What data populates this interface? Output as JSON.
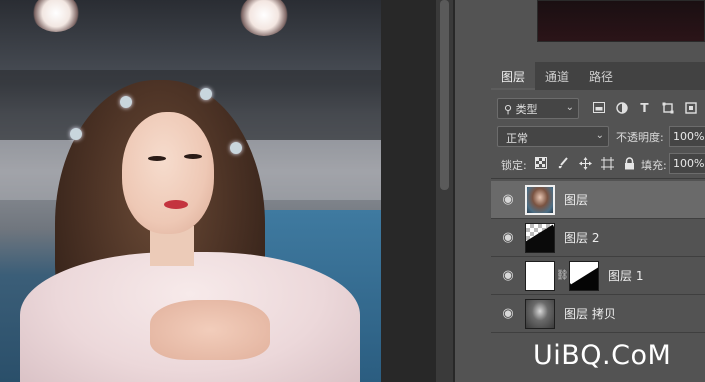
{
  "layers_panel": {
    "tabs": [
      {
        "label": "图层",
        "active": true
      },
      {
        "label": "通道",
        "active": false
      },
      {
        "label": "路径",
        "active": false
      }
    ],
    "filter": {
      "value": "类型",
      "icon": "search-icon"
    },
    "filter_icons": [
      "image-filter-icon",
      "adjustment-filter-icon",
      "type-filter-icon",
      "shape-filter-icon",
      "smart-object-filter-icon"
    ],
    "blend_mode": "正常",
    "opacity_label": "不透明度:",
    "opacity_value": "100%",
    "lock_label": "锁定:",
    "lock_icons": [
      "lock-transparent-icon",
      "lock-paint-icon",
      "lock-position-icon",
      "lock-artboard-icon",
      "lock-all-icon"
    ],
    "fill_label": "填充:",
    "fill_value": "100%",
    "layers": [
      {
        "name": "图层",
        "visible": true,
        "selected": true,
        "thumbnail": "photo"
      },
      {
        "name": "图层 2",
        "visible": true,
        "selected": false,
        "thumbnail": "transparent-mask"
      },
      {
        "name": "图层 1",
        "visible": true,
        "selected": false,
        "thumbnail": "white-with-mask"
      },
      {
        "name": "图层  拷贝",
        "visible": true,
        "selected": false,
        "thumbnail": "bw-photo"
      }
    ]
  },
  "watermark": {
    "text": "UiBQ.CoM"
  },
  "colors": {
    "panel_bg": "#535353",
    "selected_row": "#6a6a6a",
    "dark_panel": "#282828"
  }
}
